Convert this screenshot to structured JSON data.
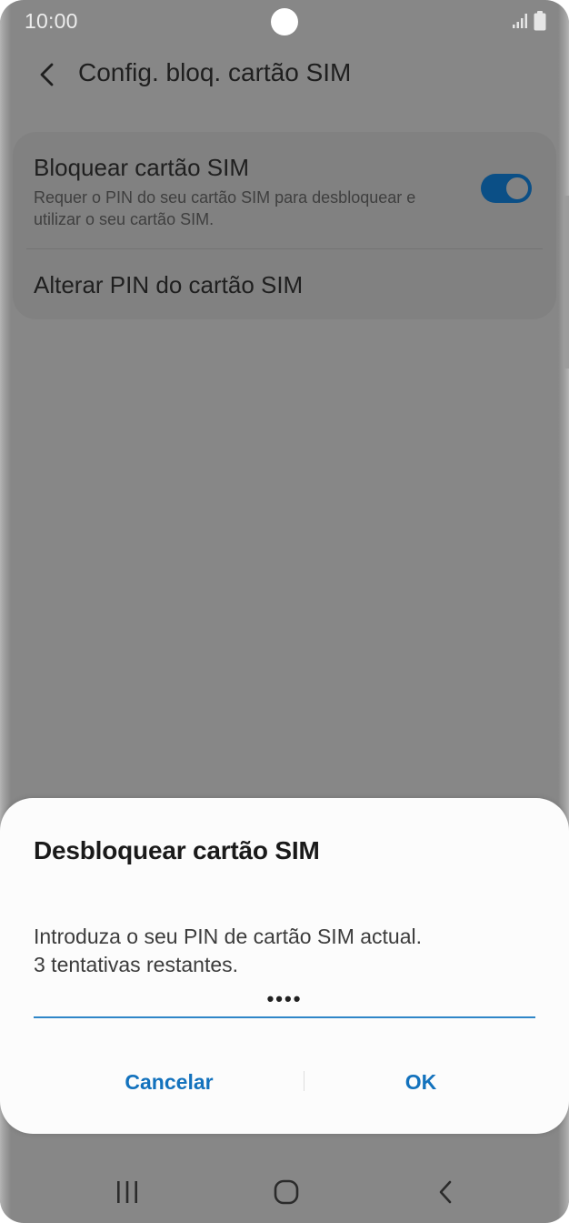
{
  "status_bar": {
    "time": "10:00",
    "icons": [
      "signal-icon",
      "battery-icon"
    ]
  },
  "header": {
    "title": "Config. bloq. cartão SIM",
    "back_icon": "back-arrow-icon"
  },
  "settings": {
    "lock_sim": {
      "title": "Bloquear cartão SIM",
      "description": "Requer o PIN do seu cartão SIM para desbloquear e utilizar o seu cartão SIM.",
      "toggle_on": true
    },
    "change_pin": {
      "label": "Alterar PIN do cartão SIM"
    }
  },
  "dialog": {
    "title": "Desbloquear cartão SIM",
    "message_line1": "Introduza o seu PIN de cartão SIM actual.",
    "message_line2": "3 tentativas restantes.",
    "pin_value": "••••",
    "cancel_label": "Cancelar",
    "ok_label": "OK"
  },
  "nav_bar": {
    "icons": [
      "recent-apps-icon",
      "home-icon",
      "back-icon"
    ]
  },
  "colors": {
    "accent": "#1372bd",
    "toggle_on": "#0b4f86",
    "scrim_background": "#878787",
    "dialog_background": "#fcfcfc"
  }
}
